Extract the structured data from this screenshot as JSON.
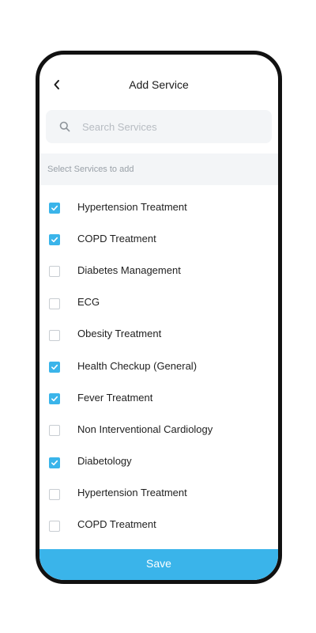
{
  "header": {
    "title": "Add Service",
    "back_icon": "chevron-left-icon"
  },
  "search": {
    "placeholder": "Search Services",
    "value": "",
    "icon": "search-icon"
  },
  "section": {
    "label": "Select Services to add"
  },
  "services": [
    {
      "label": "Hypertension Treatment",
      "checked": true
    },
    {
      "label": "COPD Treatment",
      "checked": true
    },
    {
      "label": "Diabetes Management",
      "checked": false
    },
    {
      "label": "ECG",
      "checked": false
    },
    {
      "label": "Obesity Treatment",
      "checked": false
    },
    {
      "label": "Health Checkup (General)",
      "checked": true
    },
    {
      "label": "Fever Treatment",
      "checked": true
    },
    {
      "label": "Non Interventional Cardiology",
      "checked": false
    },
    {
      "label": "Diabetology",
      "checked": true
    },
    {
      "label": "Hypertension Treatment",
      "checked": false
    },
    {
      "label": "COPD Treatment",
      "checked": false
    }
  ],
  "footer": {
    "save_label": "Save"
  },
  "colors": {
    "accent": "#3ab4ea",
    "field_background": "#f3f5f7",
    "frame": "#111111"
  }
}
